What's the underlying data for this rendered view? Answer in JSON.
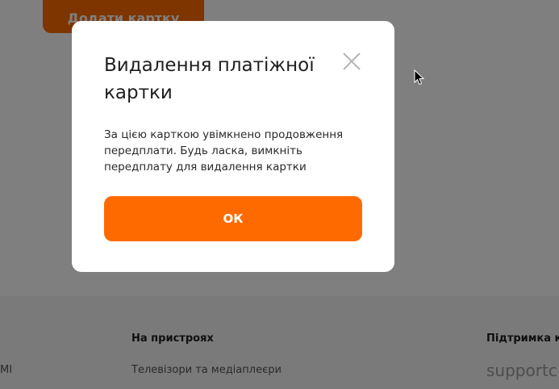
{
  "page": {
    "add_card_label": "Додати картку"
  },
  "footer": {
    "left_fragment": "MI",
    "devices": {
      "heading": "На пристроях",
      "link": "Телевізори та медіаплеєри"
    },
    "support": {
      "heading": "Підтримка кор",
      "email": "supportc"
    }
  },
  "modal": {
    "title": "Видалення платіжної картки",
    "message": "За цією карткою увімкнено продовження передплати. Будь ласка, вимкніть передплату для видалення картки",
    "ok_label": "ОК",
    "close_icon": "close-icon"
  },
  "colors": {
    "accent": "#ff6a00",
    "overlay": "rgba(0,0,0,0.5)",
    "text": "#1e1e1e"
  }
}
